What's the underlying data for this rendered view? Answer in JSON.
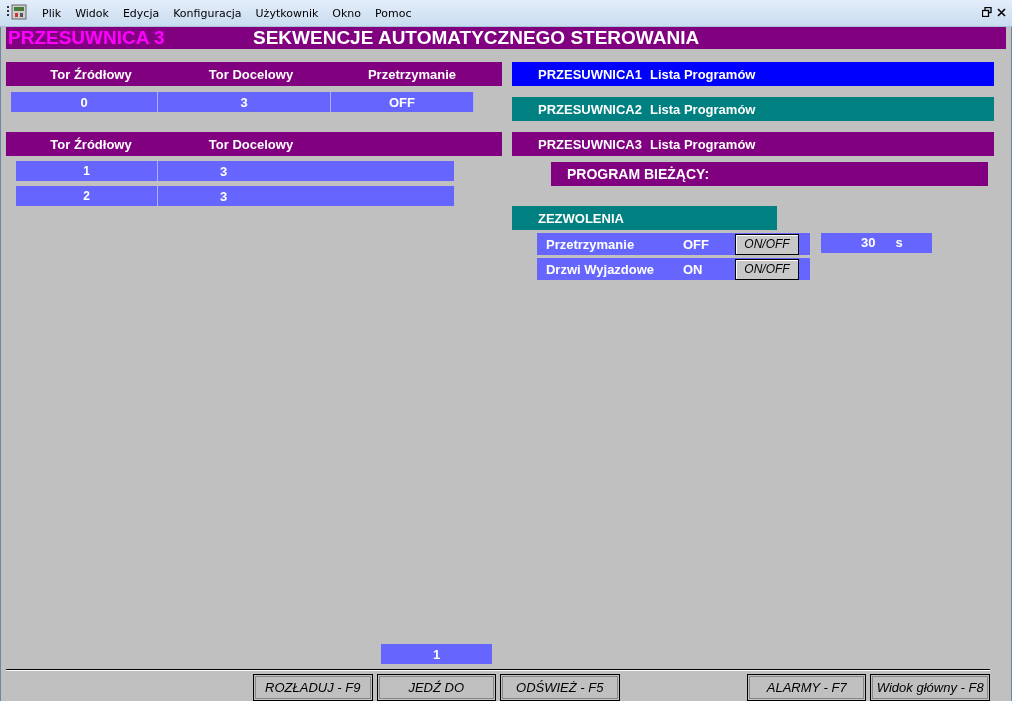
{
  "menu": [
    "Plik",
    "Widok",
    "Edycja",
    "Konfiguracja",
    "Użytkownik",
    "Okno",
    "Pomoc"
  ],
  "header": {
    "device": "PRZESUWNICA 3",
    "title": "SEKWENCJE AUTOMATYCZNEGO STEROWANIA"
  },
  "current_table": {
    "columns": [
      "Tor Źródłowy",
      "Tor Docelowy",
      "Przetrzymanie"
    ],
    "rows": [
      [
        "0",
        "3",
        "OFF"
      ]
    ]
  },
  "sequence_table": {
    "columns": [
      "Tor Źródłowy",
      "Tor Docelowy"
    ],
    "rows": [
      [
        "1",
        "3"
      ],
      [
        "2",
        "3"
      ]
    ]
  },
  "program_lists": [
    {
      "device": "PRZESUWNICA1",
      "label": "Lista Programów",
      "color": "#0000ff"
    },
    {
      "device": "PRZESUWNICA2",
      "label": "Lista Programów",
      "color": "#008080"
    },
    {
      "device": "PRZESUWNICA3",
      "label": "Lista Programów",
      "color": "#800080"
    }
  ],
  "current_program": {
    "label": "PROGRAM BIEŻĄCY:"
  },
  "permissions": {
    "title": "ZEZWOLENIA",
    "items": [
      {
        "label": "Przetrzymanie",
        "state": "OFF",
        "button": "ON/OFF",
        "time": "30",
        "unit": "s"
      },
      {
        "label": "Drzwi Wyjazdowe",
        "state": "ON",
        "button": "ON/OFF"
      }
    ]
  },
  "page": "1",
  "buttons_left": [
    "ROZŁADUJ - F9",
    "JEDŹ DO",
    "ODŚWIEŻ - F5"
  ],
  "buttons_right": [
    "ALARMY - F7",
    "Widok główny - F8"
  ]
}
